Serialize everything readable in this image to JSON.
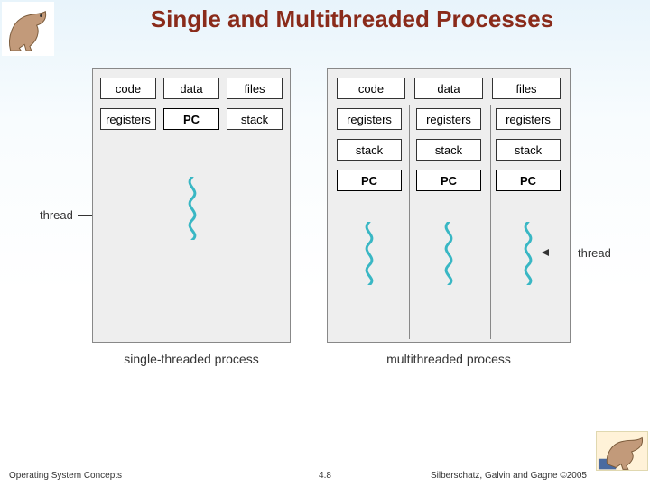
{
  "title": "Single and Multithreaded Processes",
  "footer": {
    "left": "Operating System Concepts",
    "center": "4.8",
    "right": "Silberschatz, Galvin and Gagne ©2005"
  },
  "diagram": {
    "single": {
      "shared": {
        "code": "code",
        "data": "data",
        "files": "files"
      },
      "row2": {
        "registers": "registers",
        "pc": "PC",
        "stack": "stack"
      },
      "caption": "single-threaded process",
      "thread_label": "thread"
    },
    "multi": {
      "shared": {
        "code": "code",
        "data": "data",
        "files": "files"
      },
      "cols": [
        {
          "registers": "registers",
          "stack": "stack",
          "pc": "PC"
        },
        {
          "registers": "registers",
          "stack": "stack",
          "pc": "PC"
        },
        {
          "registers": "registers",
          "stack": "stack",
          "pc": "PC"
        }
      ],
      "caption": "multithreaded process",
      "thread_label": "thread"
    }
  },
  "icons": {
    "logo_tl": "dinosaur-logo",
    "logo_br": "dinosaur-logo-small"
  }
}
